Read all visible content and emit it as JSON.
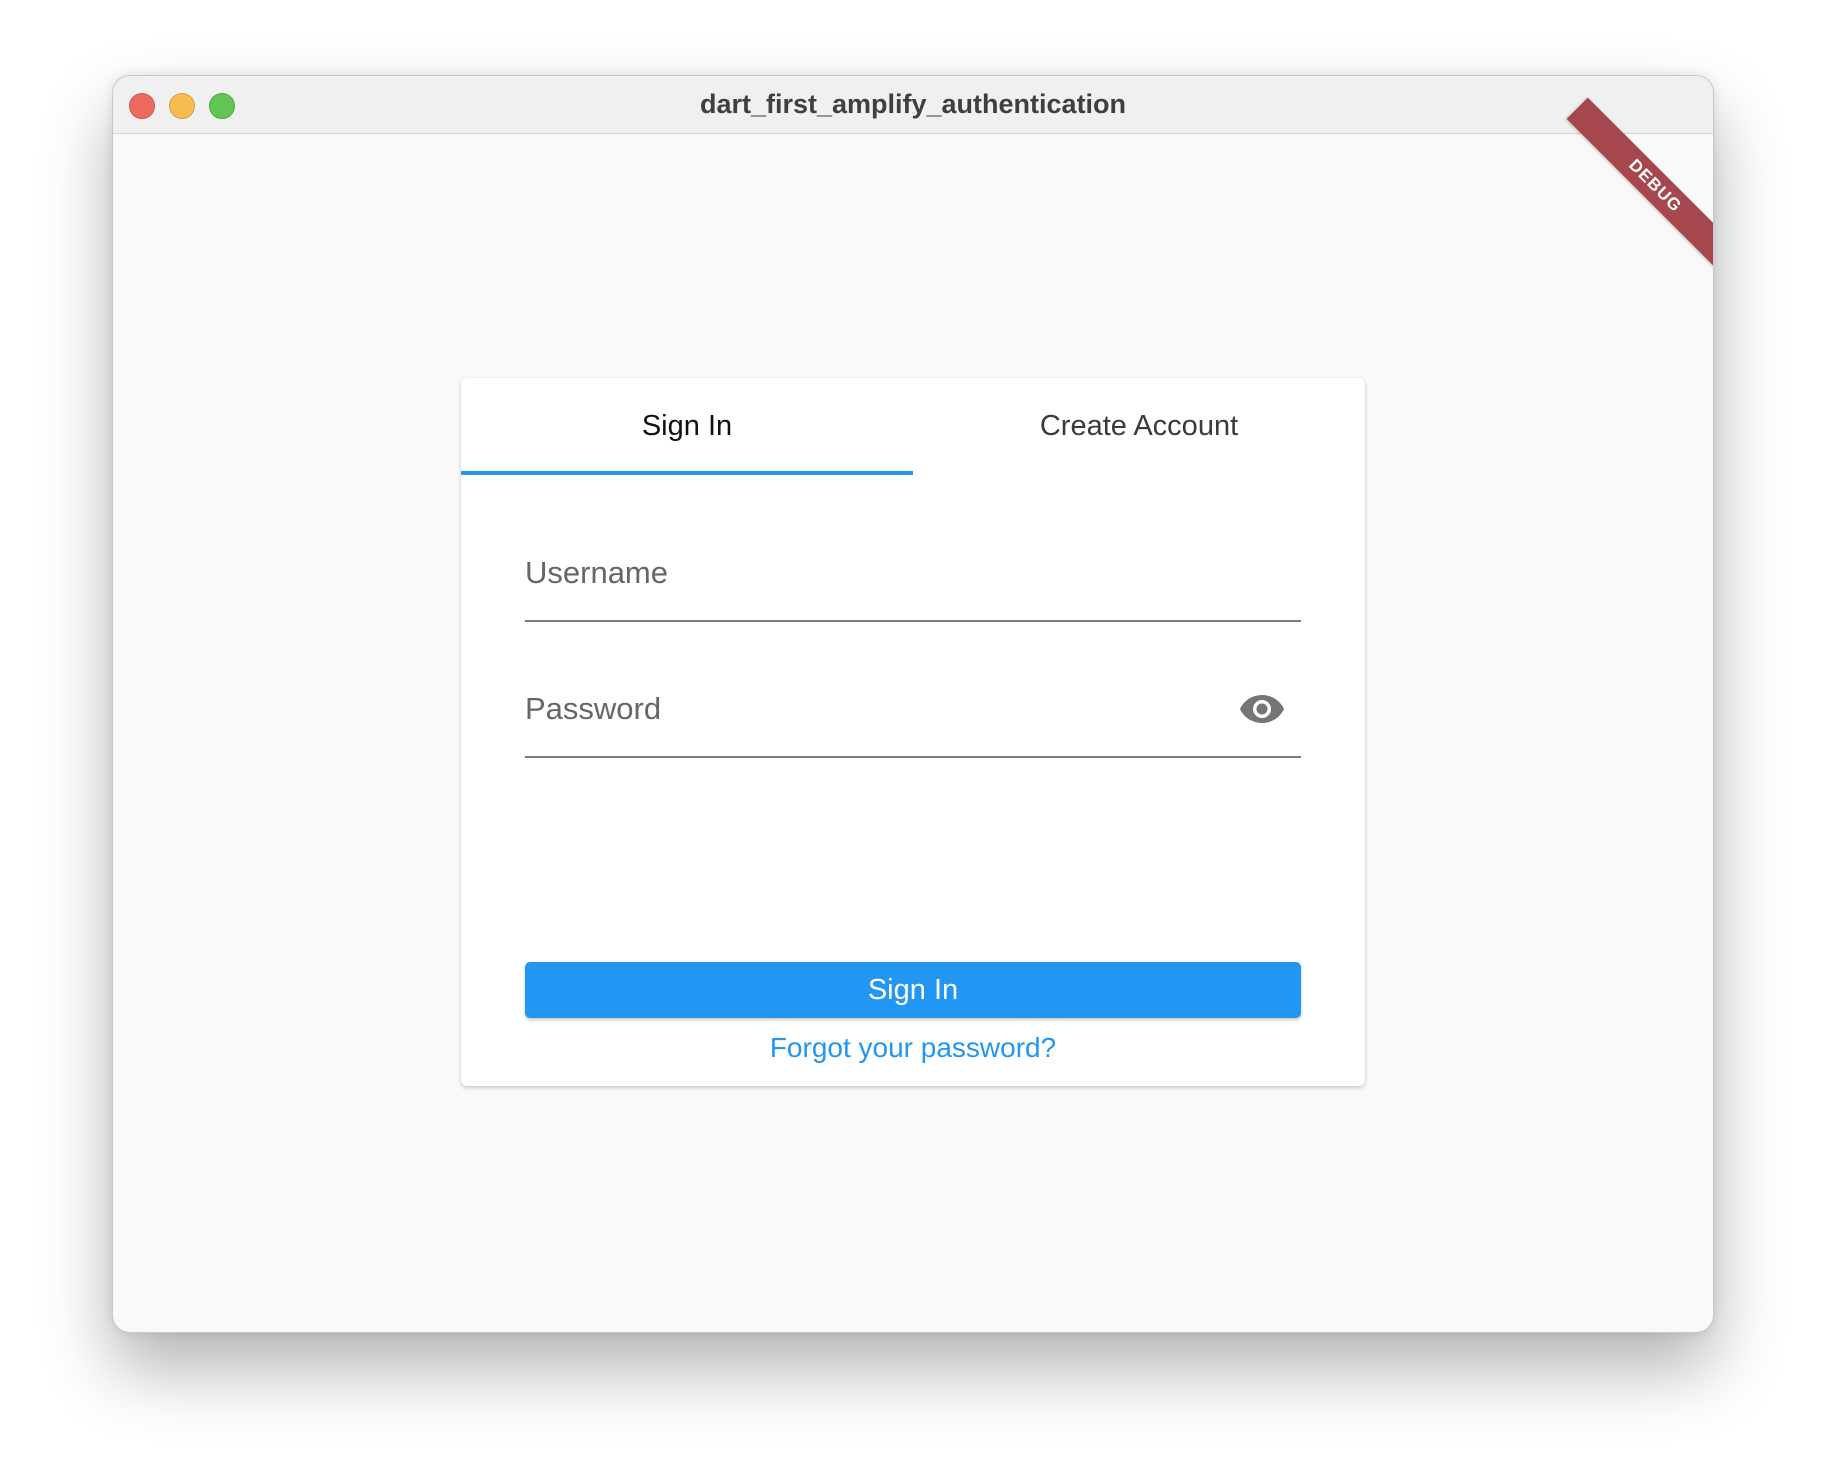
{
  "window": {
    "title": "dart_first_amplify_authentication",
    "debug_banner": "DEBUG"
  },
  "auth": {
    "tabs": [
      {
        "label": "Sign In",
        "selected": true
      },
      {
        "label": "Create Account",
        "selected": false
      }
    ],
    "username": {
      "placeholder": "Username",
      "value": ""
    },
    "password": {
      "placeholder": "Password",
      "value": ""
    },
    "sign_in_button": "Sign In",
    "forgot_link": "Forgot your password?"
  },
  "colors": {
    "accent": "#2196f3",
    "debug": "#a5474c",
    "close": "#ee6a5e",
    "minimize": "#f5be4f",
    "maximize": "#61c454"
  },
  "icons": {
    "password_toggle": "eye-icon"
  }
}
